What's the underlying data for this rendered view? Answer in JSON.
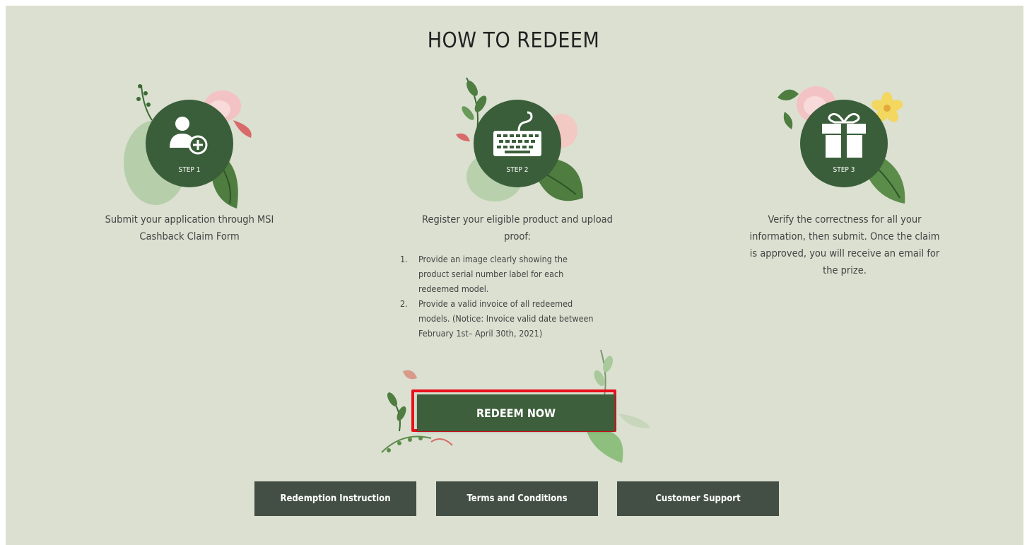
{
  "page": {
    "title": "HOW TO REDEEM"
  },
  "steps": [
    {
      "badge": "STEP 1",
      "icon": "add-user-icon",
      "description_lines": [
        "Submit your application through MSI",
        "Cashback Claim Form"
      ]
    },
    {
      "badge": "STEP 2",
      "icon": "keyboard-icon",
      "description_lines": [
        "Register your eligible product and upload",
        "proof:"
      ],
      "sub_items": [
        {
          "num": "1.",
          "lines": [
            "Provide an image clearly showing the",
            "product serial number label for each",
            "redeemed model."
          ]
        },
        {
          "num": "2.",
          "lines": [
            "Provide a valid invoice of all redeemed",
            "models. (Notice: Invoice valid date between",
            "February 1st– April 30th, 2021)"
          ]
        }
      ]
    },
    {
      "badge": "STEP 3",
      "icon": "gift-icon",
      "description_lines": [
        "Verify the correctness for all your",
        "information, then submit. Once the claim",
        "is approved, you will receive an email for",
        "the prize."
      ]
    }
  ],
  "redeem_button": {
    "label": "REDEEM NOW",
    "highlight_color": "#e8101a"
  },
  "bottom_buttons": [
    {
      "label": "Redemption Instruction"
    },
    {
      "label": "Terms and Conditions"
    },
    {
      "label": "Customer Support"
    }
  ],
  "colors": {
    "background": "#dbe0d1",
    "circle": "#3b5e3a",
    "primary_button": "#3e5f3c",
    "secondary_button": "#434f44"
  }
}
